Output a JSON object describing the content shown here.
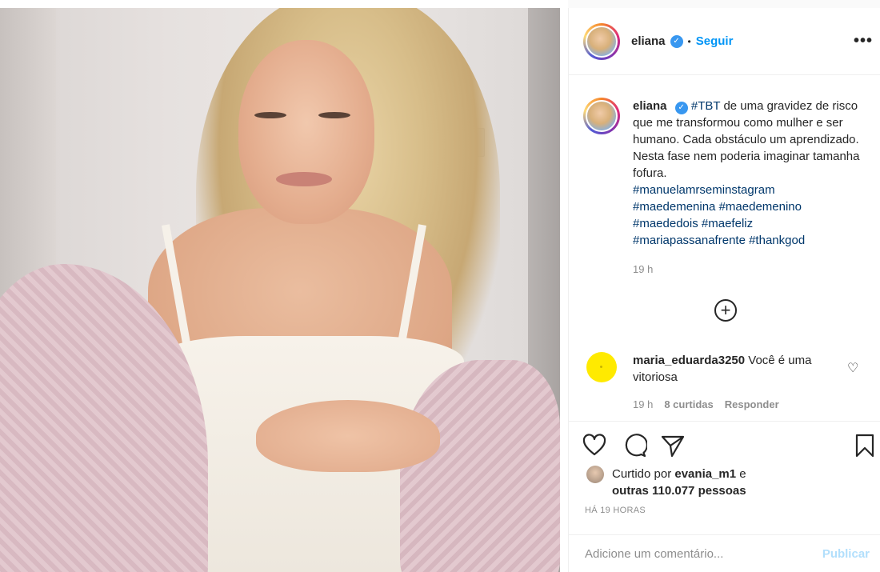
{
  "post": {
    "username": "eliana",
    "follow_label": "Seguir",
    "separator": "•",
    "more_label": "•••",
    "caption_username": "eliana",
    "caption_text": " de uma gravidez de risco que me transformou como mulher e ser humano. Cada obstáculo um aprendizado. Nesta fase nem poderia imaginar tamanha fofura.",
    "tag_tbt": "#TBT",
    "hashtags": [
      "#manuelamrseminstagram",
      "#maedemenina",
      "#maedemenino",
      "#maededois",
      "#maefeliz",
      "#mariapassanafrente",
      "#thankgod"
    ],
    "caption_time": "19 h",
    "load_more_symbol": "+"
  },
  "comment": {
    "username": "maria_eduarda3250",
    "text": " Você é uma vitoriosa",
    "time": "19 h",
    "likes": "8 curtidas",
    "reply_label": "Responder",
    "heart_symbol": "♡"
  },
  "likes": {
    "prefix": "Curtido por ",
    "user": "evania_m1",
    "middle": " e",
    "others": "outras 110.077 pessoas"
  },
  "time_ago": "HÁ 19 HORAS",
  "add_comment": {
    "placeholder": "Adicione um comentário...",
    "publish_label": "Publicar"
  },
  "icons": {
    "verified": "verified-badge-icon",
    "like": "heart-icon",
    "comment": "comment-bubble-icon",
    "share": "paper-plane-icon",
    "save": "bookmark-icon"
  },
  "colors": {
    "link_blue": "#0095f6",
    "hashtag": "#00376b",
    "muted": "#8e8e8e",
    "publish_disabled": "#b2dffc",
    "verified": "#3897f0"
  }
}
